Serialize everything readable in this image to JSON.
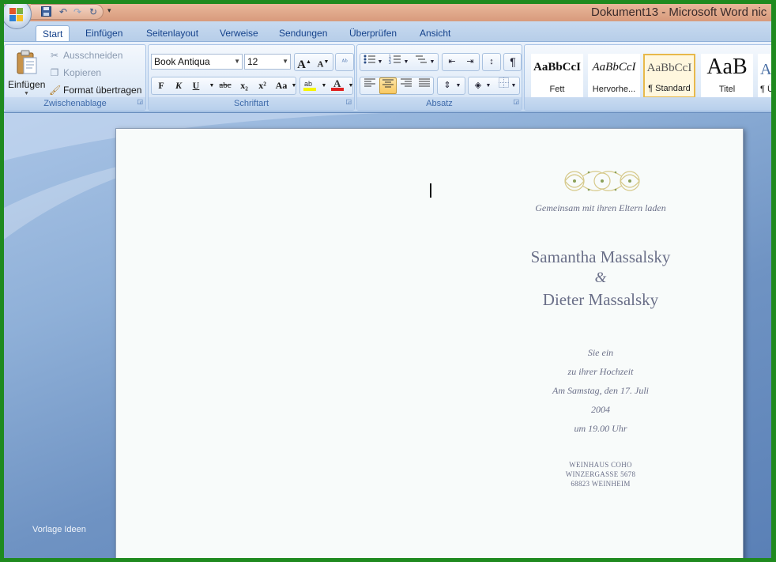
{
  "window": {
    "title": "Dokument13 - Microsoft Word nic"
  },
  "quick_access": {
    "icons": [
      "save-icon",
      "undo-icon",
      "redo-icon",
      "repeat-icon"
    ],
    "customize": "▾"
  },
  "tabs": [
    {
      "label": "Start",
      "active": true
    },
    {
      "label": "Einfügen"
    },
    {
      "label": "Seitenlayout"
    },
    {
      "label": "Verweise"
    },
    {
      "label": "Sendungen"
    },
    {
      "label": "Überprüfen"
    },
    {
      "label": "Ansicht"
    }
  ],
  "ribbon": {
    "clipboard": {
      "label": "Zwischenablage",
      "paste": "Einfügen",
      "cut": "Ausschneiden",
      "copy": "Kopieren",
      "format_painter": "Format übertragen"
    },
    "font": {
      "label": "Schriftart",
      "font_name": "Book Antiqua",
      "font_size": "12",
      "bold": "F",
      "italic": "K",
      "underline": "U",
      "strike": "abc",
      "subscript": "x₂",
      "superscript": "x²",
      "change_case": "Aa",
      "grow": "A",
      "shrink": "A",
      "highlight_color": "#f5f500",
      "font_color": "#e02020"
    },
    "paragraph": {
      "label": "Absatz",
      "pilcrow": "¶"
    },
    "styles": {
      "items": [
        {
          "sample": "AaBbCcI",
          "name": "Fett"
        },
        {
          "sample": "AaBbCcI",
          "name": "Hervorhe..."
        },
        {
          "sample": "AaBbCcI",
          "name": "¶ Standard",
          "selected": true
        },
        {
          "sample": "AaB",
          "name": "Titel"
        },
        {
          "sample": "A",
          "name": "¶ Ü"
        }
      ]
    }
  },
  "document": {
    "intro": "Gemeinsam mit ihren Eltern laden",
    "name1": "Samantha Massalsky",
    "ampersand": "&",
    "name2": "Dieter Massalsky",
    "line1": "Sie ein",
    "line2": "zu ihrer Hochzeit",
    "line3": "Am Samstag, den 17.  Juli",
    "line4": "2004",
    "line5": "um 19.00 Uhr",
    "address1": "WEINHAUS COHO",
    "address2": "WINZERGASSE 5678",
    "address3": "68823 WEINHEIM"
  },
  "watermark": "Vorlage Ideen"
}
